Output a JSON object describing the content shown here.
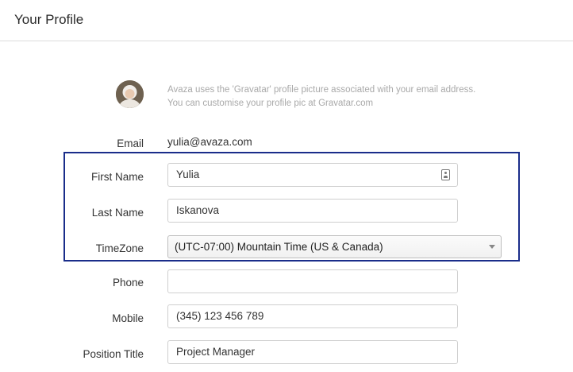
{
  "header": {
    "title": "Your Profile"
  },
  "gravatar": {
    "note": "Avaza uses the 'Gravatar' profile picture associated with your email address. You can customise your profile pic at Gravatar.com"
  },
  "form": {
    "email": {
      "label": "Email",
      "value": "yulia@avaza.com"
    },
    "first_name": {
      "label": "First Name",
      "value": "Yulia"
    },
    "last_name": {
      "label": "Last Name",
      "value": "Iskanova"
    },
    "timezone": {
      "label": "TimeZone",
      "value": "(UTC-07:00) Mountain Time (US & Canada)"
    },
    "phone": {
      "label": "Phone",
      "value": ""
    },
    "mobile": {
      "label": "Mobile",
      "value": "(345) 123 456 789"
    },
    "position_title": {
      "label": "Position Title",
      "value": "Project Manager"
    }
  },
  "colors": {
    "highlight_border": "#1a2d8a",
    "gravatar_text": "#a9a9a9"
  },
  "icons": {
    "first_name_field": "contact-card-icon",
    "timezone_select": "chevron-down-icon"
  }
}
